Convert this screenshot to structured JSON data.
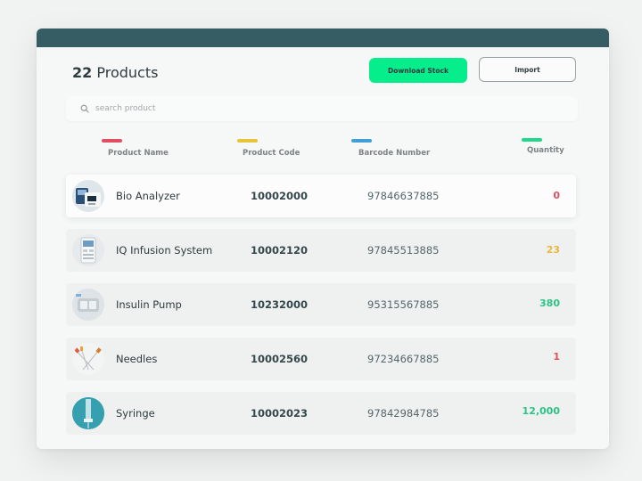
{
  "header": {
    "count": "22",
    "title_word": "Products",
    "download_label": "Download Stock",
    "import_label": "Import"
  },
  "search": {
    "placeholder": "search product",
    "icon": "search-icon"
  },
  "columns": [
    {
      "label": "Product Name",
      "color": "#e24e61"
    },
    {
      "label": "Product Code",
      "color": "#e6c43a"
    },
    {
      "label": "Barcode Number",
      "color": "#3f9fd6"
    },
    {
      "label": "Quantity",
      "color": "#1fd88a"
    }
  ],
  "quantity_colors": {
    "zero": "#e24e61",
    "low": "#e6b93a",
    "good": "#2cc486",
    "critical": "#e24e61"
  },
  "products": [
    {
      "name": "Bio Analyzer",
      "code": "10002000",
      "barcode": "97846637885",
      "quantity": "0",
      "qty_color": "#e24e61",
      "icon": "bio-analyzer-thumbnail"
    },
    {
      "name": "IQ Infusion System",
      "code": "10002120",
      "barcode": "97845513885",
      "quantity": "23",
      "qty_color": "#e6b93a",
      "icon": "infusion-system-thumbnail"
    },
    {
      "name": "Insulin Pump",
      "code": "10232000",
      "barcode": "95315567885",
      "quantity": "380",
      "qty_color": "#2cc486",
      "icon": "insulin-pump-thumbnail"
    },
    {
      "name": "Needles",
      "code": "10002560",
      "barcode": "97234667885",
      "quantity": "1",
      "qty_color": "#e24e61",
      "icon": "needles-thumbnail"
    },
    {
      "name": "Syringe",
      "code": "10002023",
      "barcode": "97842984785",
      "quantity": "12,000",
      "qty_color": "#2cc486",
      "icon": "syringe-thumbnail"
    }
  ]
}
